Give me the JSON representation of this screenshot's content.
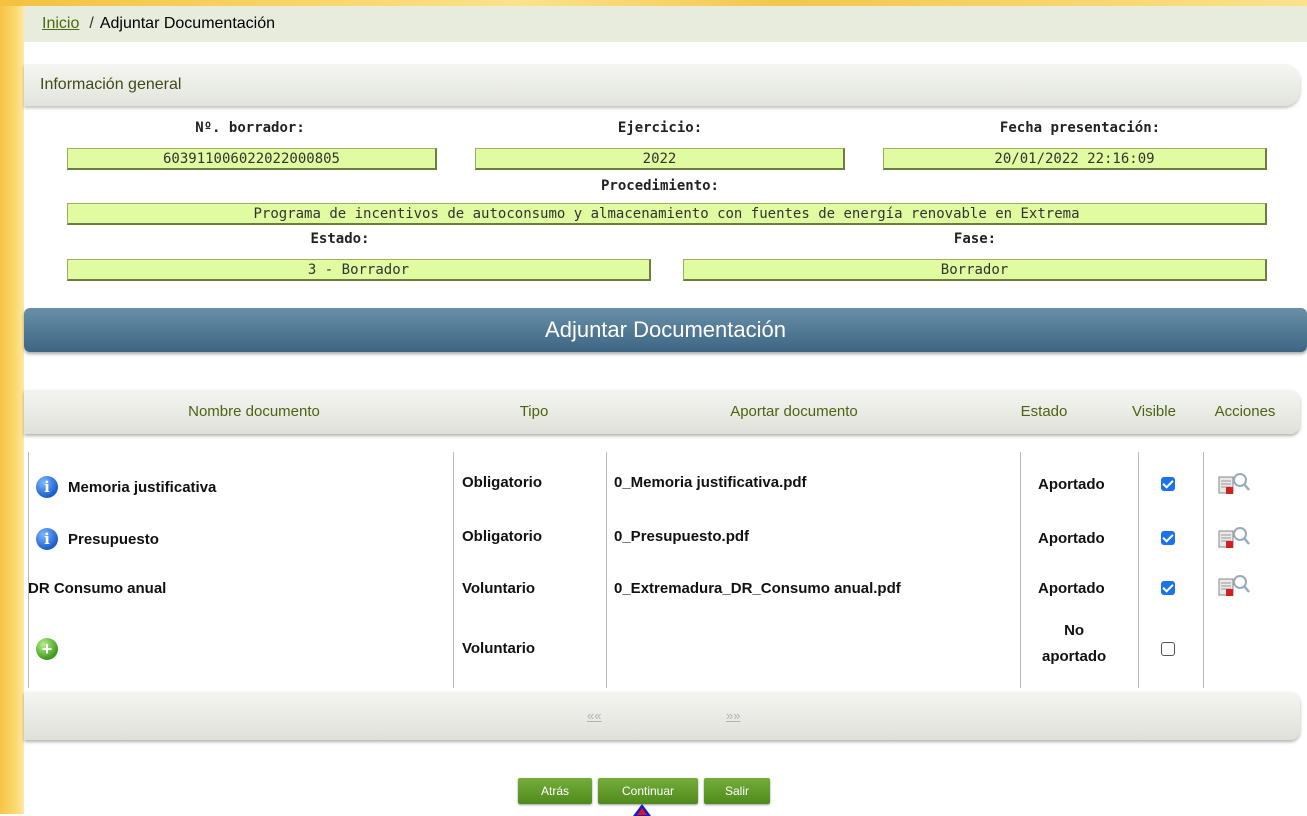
{
  "breadcrumb": {
    "home": "Inicio",
    "separator": "/",
    "current": "Adjuntar Documentación"
  },
  "general": {
    "title": "Información general",
    "borrador_label": "Nº. borrador:",
    "borrador_value": "603911006022022000805",
    "ejercicio_label": "Ejercicio:",
    "ejercicio_value": "2022",
    "fecha_label": "Fecha presentación:",
    "fecha_value": "20/01/2022 22:16:09",
    "procedimiento_label": "Procedimiento:",
    "procedimiento_value": "Programa de incentivos de autoconsumo y almacenamiento con fuentes de energía renovable en Extrema",
    "estado_label": "Estado:",
    "estado_value": "3 - Borrador",
    "fase_label": "Fase:",
    "fase_value": "Borrador"
  },
  "section_title": "Adjuntar Documentación",
  "table": {
    "headers": [
      "Nombre documento",
      "Tipo",
      "Aportar documento",
      "Estado",
      "Visible",
      "Acciones"
    ],
    "rows": [
      {
        "name": "Memoria justificativa",
        "info": true,
        "tipo": "Obligatorio",
        "file": "0_Memoria justificativa.pdf",
        "estado": "Aportado",
        "visible": true
      },
      {
        "name": "Presupuesto",
        "info": true,
        "tipo": "Obligatorio",
        "file": "0_Presupuesto.pdf",
        "estado": "Aportado",
        "visible": true
      },
      {
        "name": "DR Consumo anual",
        "info": false,
        "tipo": "Voluntario",
        "file": "0_Extremadura_DR_Consumo anual.pdf",
        "estado": "Aportado",
        "visible": true
      },
      {
        "name": "",
        "add": true,
        "tipo": "Voluntario",
        "file": "",
        "estado_line1": "No",
        "estado_line2": "aportado",
        "visible": false
      }
    ]
  },
  "pager": {
    "prev": "««",
    "next": "»»"
  },
  "buttons": {
    "back": "Atrás",
    "continue": "Continuar",
    "exit": "Salir"
  },
  "colors": {
    "field_bg": "#e0fba0",
    "accent_green": "#4f8a1c",
    "section_blue": "#3e6582"
  }
}
